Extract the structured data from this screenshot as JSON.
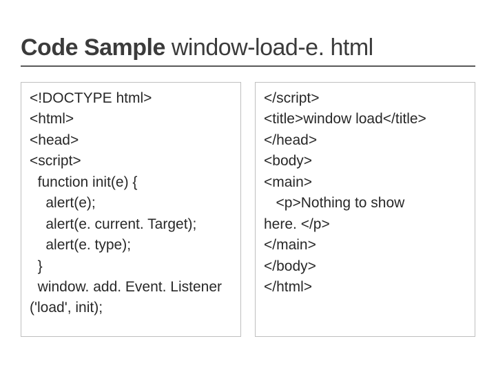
{
  "title": {
    "bold": "Code Sample ",
    "light": "window-load-e. html"
  },
  "left_code": [
    "<!DOCTYPE html>",
    "<html>",
    "<head>",
    "<script>",
    "  function init(e) {",
    "    alert(e);",
    "    alert(e. current. Target);",
    "    alert(e. type);",
    "  }",
    "  window. add. Event. Listener",
    "('load', init);"
  ],
  "right_code": [
    "</script>",
    "<title>window load</title>",
    "</head>",
    "<body>",
    "<main>",
    "   <p>Nothing to show",
    "here. </p>",
    "</main>",
    "</body>",
    "</html>"
  ]
}
